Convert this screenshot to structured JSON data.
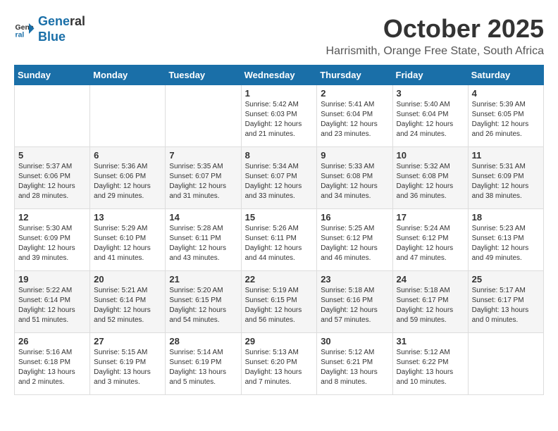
{
  "header": {
    "logo_line1": "General",
    "logo_line2": "Blue",
    "month_title": "October 2025",
    "subtitle": "Harrismith, Orange Free State, South Africa"
  },
  "weekdays": [
    "Sunday",
    "Monday",
    "Tuesday",
    "Wednesday",
    "Thursday",
    "Friday",
    "Saturday"
  ],
  "weeks": [
    [
      {
        "day": "",
        "info": ""
      },
      {
        "day": "",
        "info": ""
      },
      {
        "day": "",
        "info": ""
      },
      {
        "day": "1",
        "info": "Sunrise: 5:42 AM\nSunset: 6:03 PM\nDaylight: 12 hours\nand 21 minutes."
      },
      {
        "day": "2",
        "info": "Sunrise: 5:41 AM\nSunset: 6:04 PM\nDaylight: 12 hours\nand 23 minutes."
      },
      {
        "day": "3",
        "info": "Sunrise: 5:40 AM\nSunset: 6:04 PM\nDaylight: 12 hours\nand 24 minutes."
      },
      {
        "day": "4",
        "info": "Sunrise: 5:39 AM\nSunset: 6:05 PM\nDaylight: 12 hours\nand 26 minutes."
      }
    ],
    [
      {
        "day": "5",
        "info": "Sunrise: 5:37 AM\nSunset: 6:06 PM\nDaylight: 12 hours\nand 28 minutes."
      },
      {
        "day": "6",
        "info": "Sunrise: 5:36 AM\nSunset: 6:06 PM\nDaylight: 12 hours\nand 29 minutes."
      },
      {
        "day": "7",
        "info": "Sunrise: 5:35 AM\nSunset: 6:07 PM\nDaylight: 12 hours\nand 31 minutes."
      },
      {
        "day": "8",
        "info": "Sunrise: 5:34 AM\nSunset: 6:07 PM\nDaylight: 12 hours\nand 33 minutes."
      },
      {
        "day": "9",
        "info": "Sunrise: 5:33 AM\nSunset: 6:08 PM\nDaylight: 12 hours\nand 34 minutes."
      },
      {
        "day": "10",
        "info": "Sunrise: 5:32 AM\nSunset: 6:08 PM\nDaylight: 12 hours\nand 36 minutes."
      },
      {
        "day": "11",
        "info": "Sunrise: 5:31 AM\nSunset: 6:09 PM\nDaylight: 12 hours\nand 38 minutes."
      }
    ],
    [
      {
        "day": "12",
        "info": "Sunrise: 5:30 AM\nSunset: 6:09 PM\nDaylight: 12 hours\nand 39 minutes."
      },
      {
        "day": "13",
        "info": "Sunrise: 5:29 AM\nSunset: 6:10 PM\nDaylight: 12 hours\nand 41 minutes."
      },
      {
        "day": "14",
        "info": "Sunrise: 5:28 AM\nSunset: 6:11 PM\nDaylight: 12 hours\nand 43 minutes."
      },
      {
        "day": "15",
        "info": "Sunrise: 5:26 AM\nSunset: 6:11 PM\nDaylight: 12 hours\nand 44 minutes."
      },
      {
        "day": "16",
        "info": "Sunrise: 5:25 AM\nSunset: 6:12 PM\nDaylight: 12 hours\nand 46 minutes."
      },
      {
        "day": "17",
        "info": "Sunrise: 5:24 AM\nSunset: 6:12 PM\nDaylight: 12 hours\nand 47 minutes."
      },
      {
        "day": "18",
        "info": "Sunrise: 5:23 AM\nSunset: 6:13 PM\nDaylight: 12 hours\nand 49 minutes."
      }
    ],
    [
      {
        "day": "19",
        "info": "Sunrise: 5:22 AM\nSunset: 6:14 PM\nDaylight: 12 hours\nand 51 minutes."
      },
      {
        "day": "20",
        "info": "Sunrise: 5:21 AM\nSunset: 6:14 PM\nDaylight: 12 hours\nand 52 minutes."
      },
      {
        "day": "21",
        "info": "Sunrise: 5:20 AM\nSunset: 6:15 PM\nDaylight: 12 hours\nand 54 minutes."
      },
      {
        "day": "22",
        "info": "Sunrise: 5:19 AM\nSunset: 6:15 PM\nDaylight: 12 hours\nand 56 minutes."
      },
      {
        "day": "23",
        "info": "Sunrise: 5:18 AM\nSunset: 6:16 PM\nDaylight: 12 hours\nand 57 minutes."
      },
      {
        "day": "24",
        "info": "Sunrise: 5:18 AM\nSunset: 6:17 PM\nDaylight: 12 hours\nand 59 minutes."
      },
      {
        "day": "25",
        "info": "Sunrise: 5:17 AM\nSunset: 6:17 PM\nDaylight: 13 hours\nand 0 minutes."
      }
    ],
    [
      {
        "day": "26",
        "info": "Sunrise: 5:16 AM\nSunset: 6:18 PM\nDaylight: 13 hours\nand 2 minutes."
      },
      {
        "day": "27",
        "info": "Sunrise: 5:15 AM\nSunset: 6:19 PM\nDaylight: 13 hours\nand 3 minutes."
      },
      {
        "day": "28",
        "info": "Sunrise: 5:14 AM\nSunset: 6:19 PM\nDaylight: 13 hours\nand 5 minutes."
      },
      {
        "day": "29",
        "info": "Sunrise: 5:13 AM\nSunset: 6:20 PM\nDaylight: 13 hours\nand 7 minutes."
      },
      {
        "day": "30",
        "info": "Sunrise: 5:12 AM\nSunset: 6:21 PM\nDaylight: 13 hours\nand 8 minutes."
      },
      {
        "day": "31",
        "info": "Sunrise: 5:12 AM\nSunset: 6:22 PM\nDaylight: 13 hours\nand 10 minutes."
      },
      {
        "day": "",
        "info": ""
      }
    ]
  ]
}
